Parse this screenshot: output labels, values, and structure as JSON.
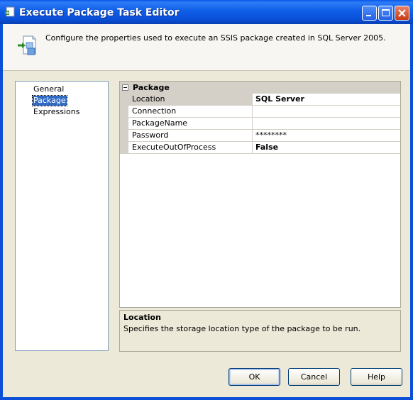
{
  "window": {
    "title": "Execute Package Task Editor",
    "controls": {
      "minimize": "minimize",
      "maximize": "maximize",
      "close": "close"
    }
  },
  "header": {
    "text": "Configure the properties used to execute an SSIS package created in SQL Server 2005."
  },
  "nav": {
    "items": [
      {
        "label": "General",
        "selected": false
      },
      {
        "label": "Package",
        "selected": true
      },
      {
        "label": "Expressions",
        "selected": false
      }
    ]
  },
  "grid": {
    "category": "Package",
    "rows": [
      {
        "name": "Location",
        "value": "SQL Server",
        "bold": true,
        "selected": true
      },
      {
        "name": "Connection",
        "value": "",
        "bold": false,
        "selected": false
      },
      {
        "name": "PackageName",
        "value": "",
        "bold": false,
        "selected": false
      },
      {
        "name": "Password",
        "value": "********",
        "bold": false,
        "selected": false
      },
      {
        "name": "ExecuteOutOfProcess",
        "value": "False",
        "bold": true,
        "selected": false
      }
    ]
  },
  "description": {
    "title": "Location",
    "text": "Specifies the storage location type of the package to be run."
  },
  "buttons": {
    "ok": "OK",
    "cancel": "Cancel",
    "help": "Help"
  },
  "colors": {
    "titlebar": "#0a4fd6",
    "selection": "#316ac5",
    "dialog_bg": "#ece9d8"
  }
}
